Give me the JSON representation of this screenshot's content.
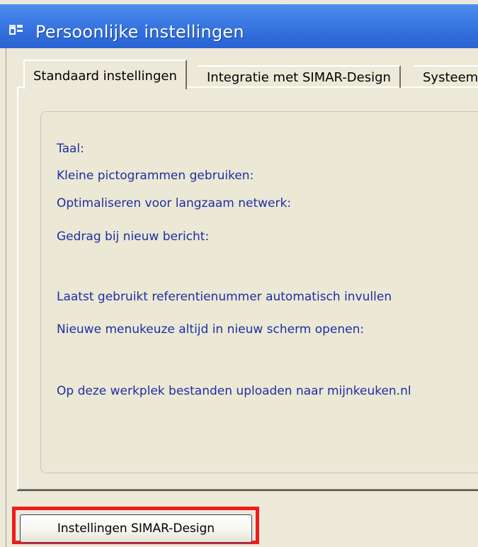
{
  "window": {
    "title": "Persoonlijke instellingen"
  },
  "tabs": [
    {
      "label": "Standaard instellingen",
      "active": true
    },
    {
      "label": "Integratie met SIMAR-Design",
      "active": false
    },
    {
      "label": "Systeem",
      "active": false
    }
  ],
  "settings": {
    "labels": [
      "Taal:",
      "Kleine pictogrammen gebruiken:",
      "Optimaliseren voor langzaam netwerk:",
      "Gedrag bij nieuw bericht:",
      "Laatst gebruikt referentienummer automatisch invullen",
      "Nieuwe menukeuze altijd in nieuw scherm openen:",
      "Op deze werkplek bestanden uploaden naar mijnkeuken.nl"
    ]
  },
  "footer": {
    "button_label": "Instellingen SIMAR-Design"
  },
  "colors": {
    "titlebar": "#2f6ad9",
    "label_text": "#1e2fa3",
    "highlight": "#ee1c1c",
    "window_bg": "#ece9d8"
  },
  "icons": {
    "title_icon": "app-window-icon"
  }
}
